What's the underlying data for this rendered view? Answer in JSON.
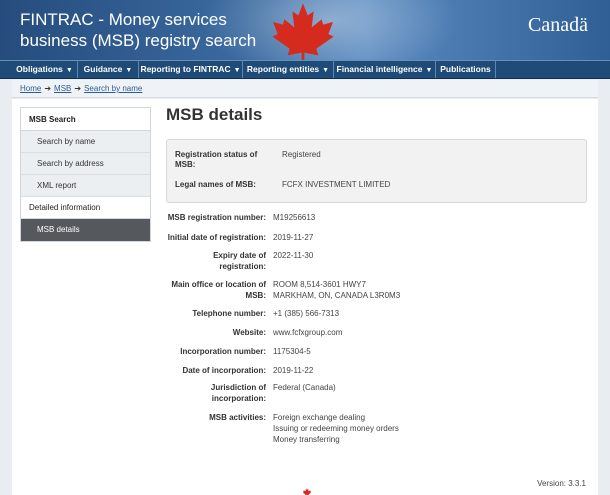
{
  "header": {
    "site_title": "FINTRAC - Money services business (MSB) registry search",
    "wordmark": "Canadä"
  },
  "nav": {
    "items": [
      {
        "label": "Obligations",
        "has_dropdown": true
      },
      {
        "label": "Guidance",
        "has_dropdown": true
      },
      {
        "label": "Reporting to FINTRAC",
        "has_dropdown": true
      },
      {
        "label": "Reporting entities",
        "has_dropdown": true
      },
      {
        "label": "Financial intelligence",
        "has_dropdown": true
      },
      {
        "label": "Publications",
        "has_dropdown": false
      }
    ]
  },
  "breadcrumb": {
    "items": [
      "Home",
      "MSB",
      "Search by name"
    ]
  },
  "sidebar": {
    "heading": "MSB Search",
    "items": [
      "Search by name",
      "Search by address",
      "XML report"
    ],
    "section": "Detailed information",
    "active": "MSB details"
  },
  "main": {
    "title": "MSB details",
    "status": {
      "registration_label": "Registration status of MSB:",
      "registration_value": "Registered",
      "legal_label": "Legal names of MSB:",
      "legal_value": "FCFX INVESTMENT LIMITED"
    },
    "details": [
      {
        "label": "MSB registration number:",
        "values": [
          "M19256613"
        ]
      },
      {
        "label": "Initial date of registration:",
        "values": [
          "2019-11-27"
        ]
      },
      {
        "label": "Expiry date of registration:",
        "values": [
          "2022-11-30"
        ]
      },
      {
        "label": "Main office or location of MSB:",
        "values": [
          "ROOM 8,514-3601 HWY7",
          "MARKHAM, ON, CANADA L3R0M3"
        ]
      },
      {
        "label": "Telephone number:",
        "values": [
          "+1 (385) 566-7313"
        ]
      },
      {
        "label": "Website:",
        "values": [
          "www.fcfxgroup.com"
        ]
      },
      {
        "label": "Incorporation number:",
        "values": [
          "1175304-5"
        ]
      },
      {
        "label": "Date of incorporation:",
        "values": [
          "2019-11-22"
        ]
      },
      {
        "label": "Jurisdiction of incorporation:",
        "values": [
          "Federal (Canada)"
        ]
      },
      {
        "label": "MSB activities:",
        "values": [
          "Foreign exchange dealing",
          "Issuing or redeeming money orders",
          "Money transferring"
        ]
      }
    ]
  },
  "footer": {
    "version": "Version: 3.3.1"
  },
  "colors": {
    "header_blue": "#2f5f95",
    "nav_blue": "#1e4b78",
    "leaf_red": "#d52b1e",
    "sidebar_active": "#55595d"
  },
  "icons": {
    "leaf": "maple-leaf-icon",
    "dropdown": "chevron-down-icon",
    "breadcrumb_separator": "arrow-right-icon"
  }
}
